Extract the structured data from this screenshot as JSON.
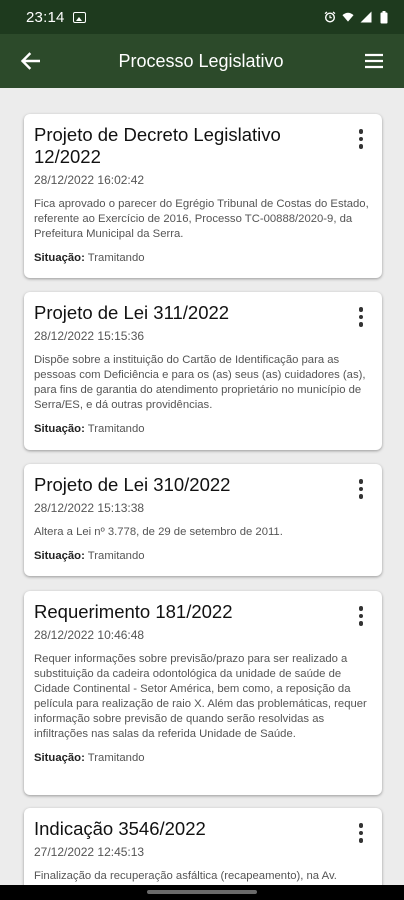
{
  "status_bar": {
    "time": "23:14",
    "icons": [
      "image-icon",
      "alarm-icon",
      "wifi-icon",
      "signal-icon",
      "battery-icon"
    ]
  },
  "app_bar": {
    "title": "Processo Legislativo",
    "back_icon": "arrow-left-icon",
    "menu_icon": "hamburger-menu-icon"
  },
  "colors": {
    "status_bar": "#1e3a1e",
    "app_bar": "#2c4a2a",
    "background": "#ececec",
    "card": "#ffffff"
  },
  "status_label": "Situação:",
  "items": [
    {
      "title": "Projeto de Decreto Legislativo 12/2022",
      "date": "28/12/2022 16:02:42",
      "description": "Fica aprovado o parecer do Egrégio Tribunal de Costas do Estado, referente ao Exercício de 2016, Processo TC-00888/2020-9, da Prefeitura Municipal da Serra.",
      "status": "Tramitando"
    },
    {
      "title": "Projeto de Lei 311/2022",
      "date": "28/12/2022 15:15:36",
      "description": "Dispõe sobre a instituição do Cartão de Identificação para as pessoas com Deficiência e para os (as) seus (as) cuidadores (as), para fins de garantia do atendimento proprietário no município de Serra/ES, e dá outras providências.",
      "status": "Tramitando"
    },
    {
      "title": "Projeto de Lei 310/2022",
      "date": "28/12/2022 15:13:38",
      "description": "Altera a Lei nº 3.778, de 29 de setembro de 2011.",
      "status": "Tramitando"
    },
    {
      "title": "Requerimento 181/2022",
      "date": "28/12/2022 10:46:48",
      "description": "Requer informações sobre previsão/prazo para ser realizado a substituição da cadeira odontológica da unidade de saúde de Cidade Continental - Setor América, bem como, a reposição da película para realização de raio X. Além das problemáticas, requer informação sobre previsão de quando serão resolvidas as infiltrações nas salas da referida Unidade de Saúde.",
      "status": "Tramitando"
    },
    {
      "title": "Indicação 3546/2022",
      "date": "27/12/2022 12:45:13",
      "description": "Finalização da recuperação asfáltica (recapeamento), na Av.",
      "status": ""
    }
  ]
}
